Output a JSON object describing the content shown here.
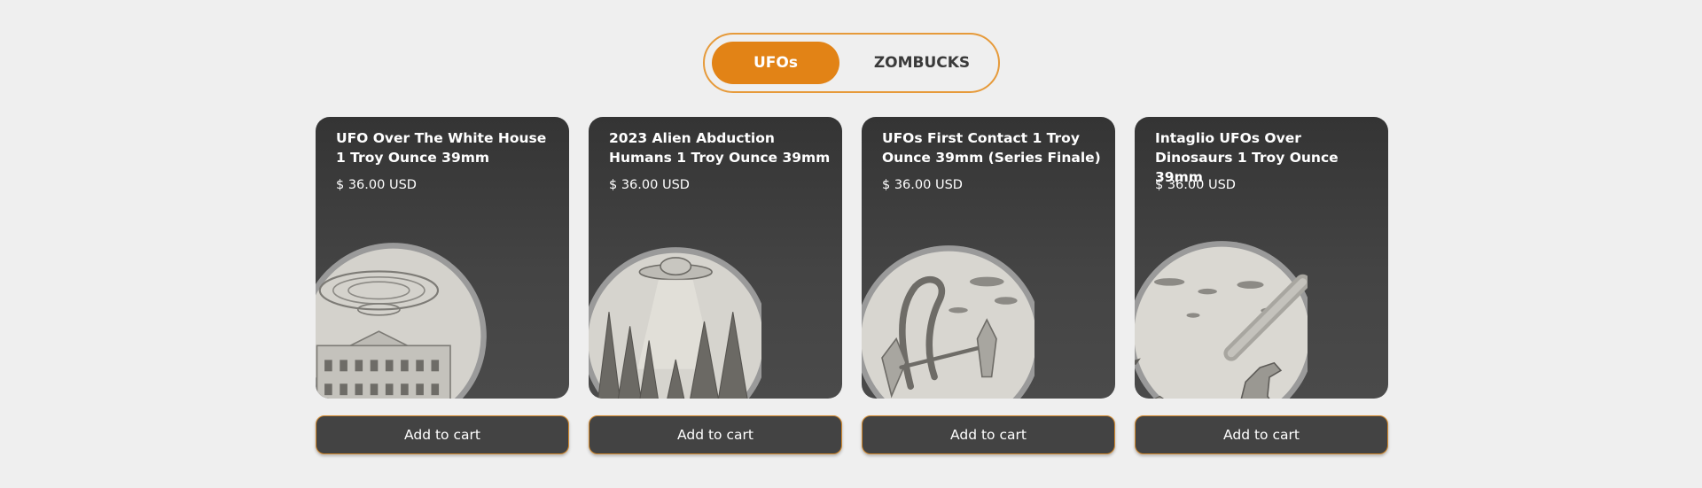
{
  "tabs": [
    {
      "label": "UFOs",
      "active": true
    },
    {
      "label": "ZOMBUCKS",
      "active": false
    }
  ],
  "products": [
    {
      "title": "UFO  Over The White House 1 Troy Ounce 39mm",
      "price": "$ 36.00 USD",
      "cart_label": "Add to cart",
      "image": "ufo-white-house-coin"
    },
    {
      "title": "2023 Alien Abduction Humans 1 Troy Ounce 39mm",
      "price": "$ 36.00 USD",
      "cart_label": "Add to cart",
      "image": "alien-abduction-coin"
    },
    {
      "title": "UFOs First Contact 1 Troy Ounce 39mm (Series Finale)",
      "price": "$ 36.00 USD",
      "cart_label": "Add to cart",
      "image": "first-contact-coin"
    },
    {
      "title": "Intaglio UFOs Over Dinosaurs 1 Troy Ounce 39mm",
      "price": "$ 36.00 USD",
      "cart_label": "Add to cart",
      "image": "ufos-dinosaurs-coin"
    }
  ],
  "colors": {
    "accent": "#e28316",
    "card_bg": "#3c3c3c",
    "page_bg": "#efefef"
  }
}
